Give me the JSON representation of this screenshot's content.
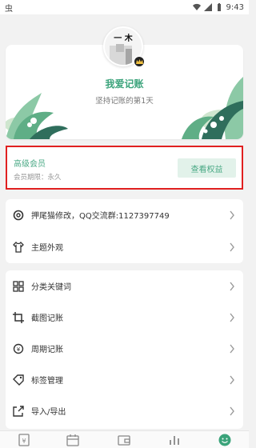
{
  "status_bar": {
    "time": "9:43",
    "left_glyph": "虫"
  },
  "profile": {
    "avatar_text": "一 木",
    "username": "我爱记账",
    "subtitle": "坚持记账的第1天"
  },
  "vip": {
    "title": "高级会员",
    "period": "会员期限：永久",
    "button": "查看权益"
  },
  "group1": [
    {
      "label": "押尾猫修改，QQ交流群:1127397749",
      "icon": "gear-icon"
    },
    {
      "label": "主题外观",
      "icon": "tshirt-icon"
    }
  ],
  "group2": [
    {
      "label": "分类关键词",
      "icon": "grid-icon"
    },
    {
      "label": "截图记账",
      "icon": "crop-icon"
    },
    {
      "label": "周期记账",
      "icon": "cycle-icon"
    },
    {
      "label": "标签管理",
      "icon": "tag-icon"
    },
    {
      "label": "导入/导出",
      "icon": "import-icon"
    }
  ],
  "colors": {
    "accent": "#3aa37a",
    "highlight_border": "#e02020"
  }
}
